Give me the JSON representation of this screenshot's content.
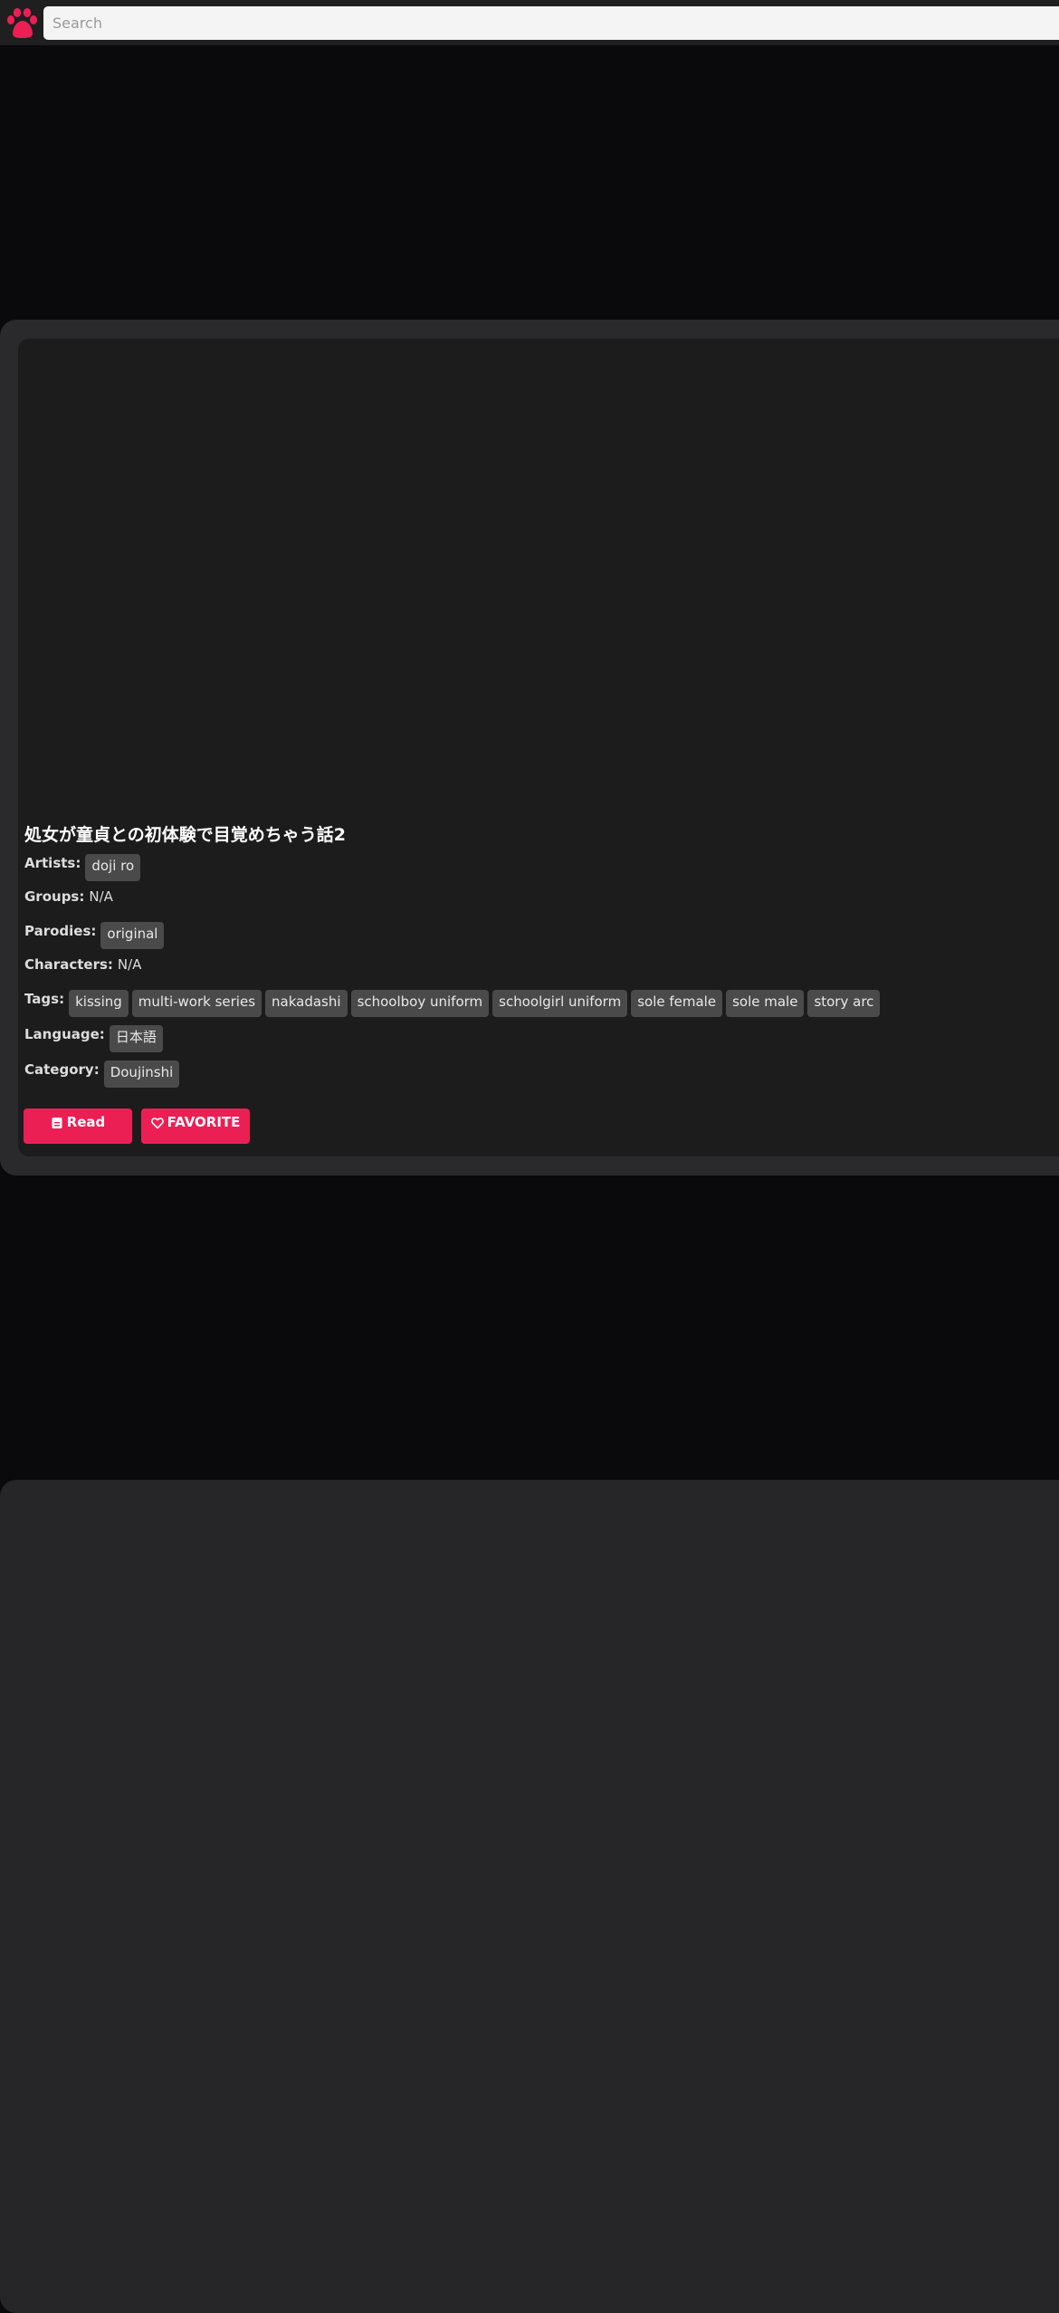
{
  "colors": {
    "accent": "#ec1f55",
    "tag_bg": "#4a4a4a",
    "card_bg": "#1c1c1c"
  },
  "header": {
    "logo_icon": "paw-icon",
    "search_placeholder": "Search"
  },
  "gallery": {
    "title": "処女が童貞との初体験で目覚めちゃう話2",
    "artists_label": "Artists:",
    "artists": [
      "doji ro"
    ],
    "groups_label": "Groups:",
    "groups_value": "N/A",
    "parodies_label": "Parodies:",
    "parodies": [
      "original"
    ],
    "characters_label": "Characters:",
    "characters_value": "N/A",
    "tags_label": "Tags:",
    "tags": [
      "kissing",
      "multi-work series",
      "nakadashi",
      "schoolboy uniform",
      "schoolgirl uniform",
      "sole female",
      "sole male",
      "story arc"
    ],
    "language_label": "Language:",
    "languages": [
      "日本語"
    ],
    "category_label": "Category:",
    "categories": [
      "Doujinshi"
    ]
  },
  "actions": {
    "read_label": "Read",
    "read_icon": "book-icon",
    "favorite_label": "FAVORITE",
    "favorite_icon": "heart-icon"
  }
}
